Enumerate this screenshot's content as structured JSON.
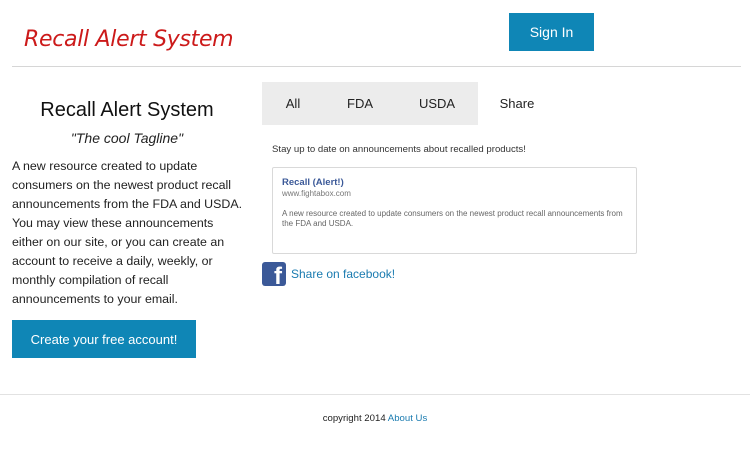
{
  "header": {
    "logo_text": "Recall Alert System",
    "sign_in_label": "Sign In"
  },
  "left": {
    "title": "Recall Alert System",
    "tagline": "\"The cool Tagline\"",
    "description": "A new resource created to update consumers on the newest product recall announcements from the FDA and USDA. You may view these announcements either on our site, or you can create an account to receive a daily, weekly, or monthly compilation of recall announcements to your email.",
    "cta_label": "Create your free account!"
  },
  "tabs": [
    {
      "label": "All"
    },
    {
      "label": "FDA"
    },
    {
      "label": "USDA"
    },
    {
      "label": "Share"
    }
  ],
  "share_panel": {
    "intro": "Stay up to date on announcements about recalled products!",
    "preview_title": "Recall (Alert!)",
    "preview_url": "www.fightabox.com",
    "preview_description": "A new resource created to update consumers on the newest product recall announcements from the FDA and USDA.",
    "facebook_label": "Share on facebook!"
  },
  "footer": {
    "copyright": "copyright 2014",
    "about_link": "About Us"
  },
  "colors": {
    "brand_red": "#cc1a1a",
    "button_blue": "#0f86b6",
    "facebook_blue": "#3b5998",
    "link_blue": "#1a7bb0"
  }
}
